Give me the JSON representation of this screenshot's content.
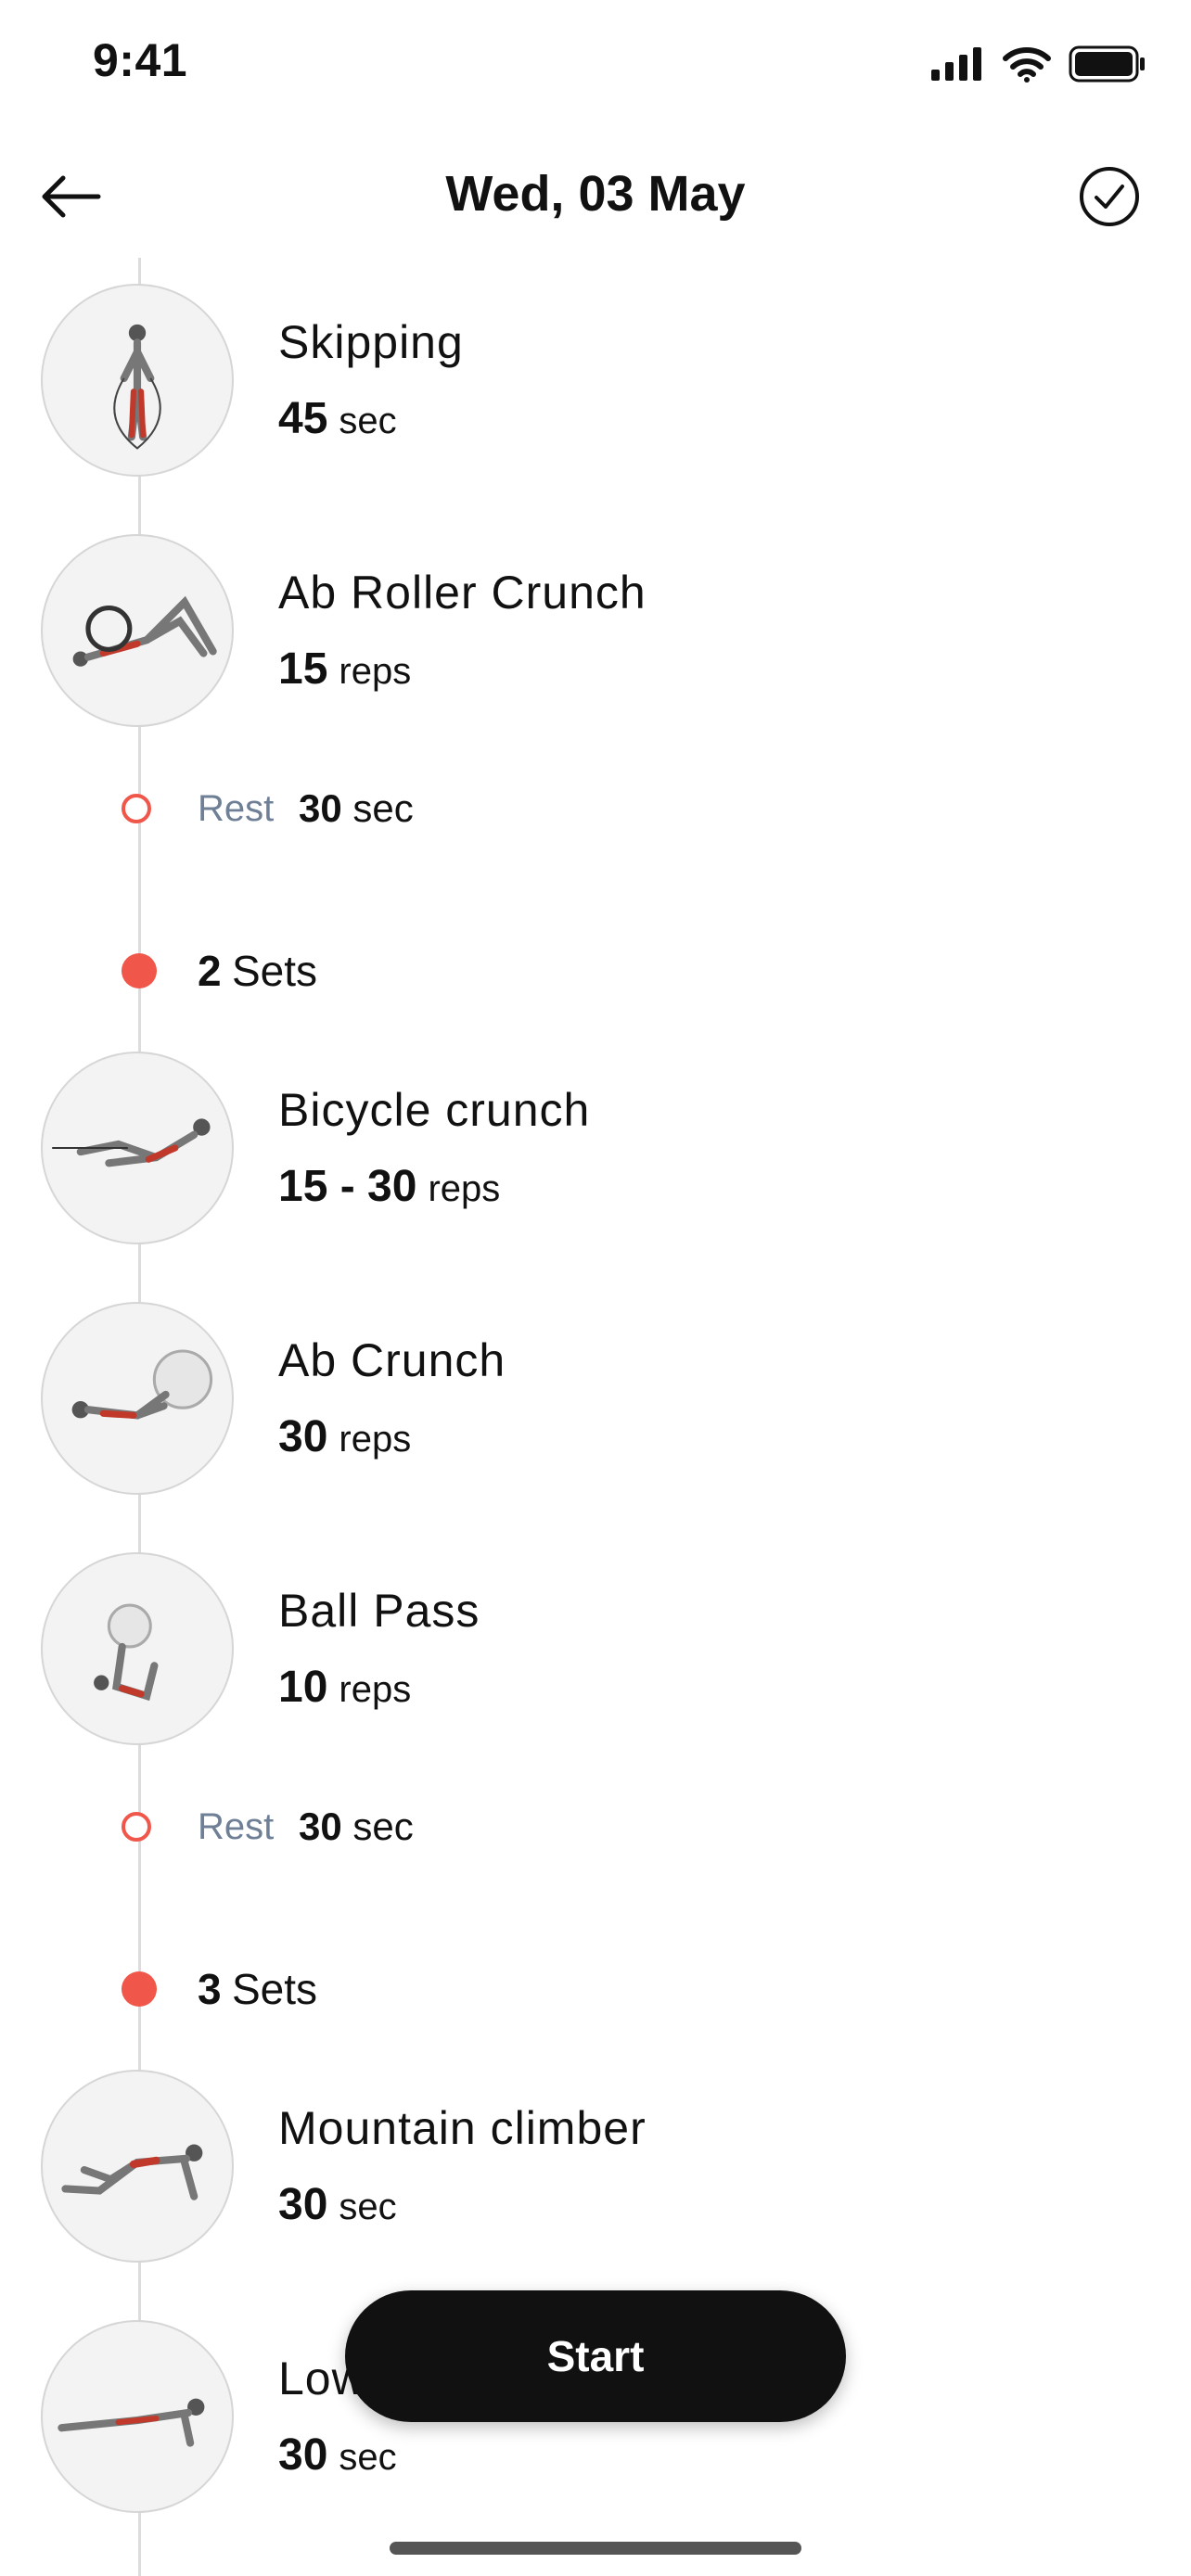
{
  "status_bar": {
    "time": "9:41"
  },
  "header": {
    "title": "Wed, 03 May",
    "back_icon": "arrow-left-icon",
    "done_icon": "check-circle-icon"
  },
  "accent_color": "#f0564a",
  "items": [
    {
      "name": "Skipping",
      "value": "45",
      "unit": "sec"
    },
    {
      "name": "Ab Roller Crunch",
      "value": "15",
      "unit": "reps"
    },
    {
      "rest_label": "Rest",
      "rest_value": "30",
      "rest_unit": "sec"
    },
    {
      "sets_count": "2",
      "sets_label": "Sets"
    },
    {
      "name": "Bicycle crunch",
      "value": "15 - 30",
      "unit": "reps"
    },
    {
      "name": "Ab Crunch",
      "value": "30",
      "unit": "reps"
    },
    {
      "name": "Ball Pass",
      "value": "10",
      "unit": "reps"
    },
    {
      "rest_label": "Rest",
      "rest_value": "30",
      "rest_unit": "sec"
    },
    {
      "sets_count": "3",
      "sets_label": "Sets"
    },
    {
      "name": "Mountain climber",
      "value": "30",
      "unit": "sec"
    },
    {
      "name": "Low",
      "value": "30",
      "unit": "sec"
    }
  ],
  "start_button": {
    "label": "Start"
  }
}
